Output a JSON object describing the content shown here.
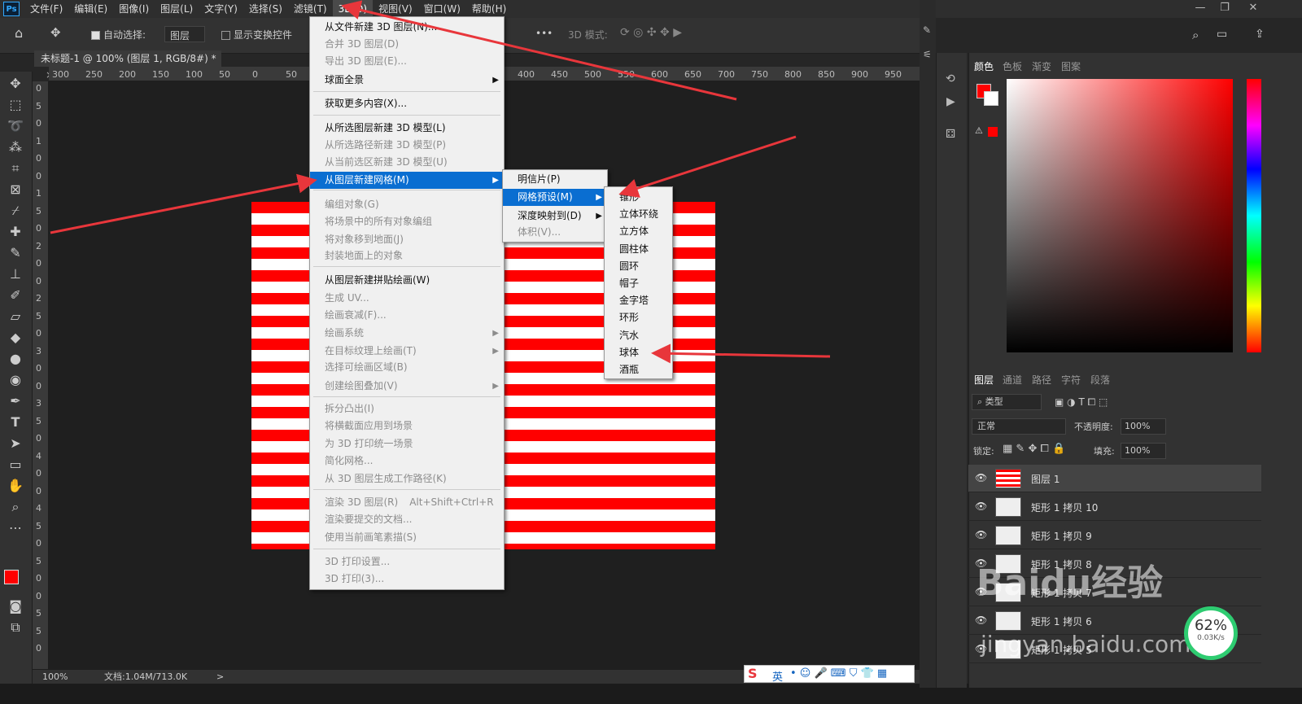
{
  "app": {
    "logo": "Ps"
  },
  "menubar": [
    "文件(F)",
    "编辑(E)",
    "图像(I)",
    "图层(L)",
    "文字(Y)",
    "选择(S)",
    "滤镜(T)",
    "3D(D)",
    "视图(V)",
    "窗口(W)",
    "帮助(H)"
  ],
  "window_controls": {
    "minimize": "—",
    "restore": "❐",
    "close": "✕"
  },
  "options_bar": {
    "auto_select_label": "自动选择:",
    "auto_select_value": "图层",
    "show_transform_label": "显示变换控件",
    "mode_3d_label": "3D 模式:",
    "more": "•••"
  },
  "document_tab": {
    "title": "未标题-1 @ 100% (图层 1, RGB/8#) *",
    "close": "×"
  },
  "hruler_ticks": [
    "300",
    "250",
    "200",
    "150",
    "100",
    "50",
    "0",
    "50",
    "400",
    "450",
    "500",
    "550",
    "600",
    "650",
    "700",
    "750",
    "800",
    "850",
    "900",
    "950"
  ],
  "vruler_ticks": [
    "0",
    "5",
    "0",
    "1",
    "0",
    "0",
    "1",
    "5",
    "0",
    "2",
    "0",
    "0",
    "2",
    "5",
    "0",
    "3",
    "0",
    "0",
    "3",
    "5",
    "0",
    "4",
    "0",
    "0",
    "4",
    "5",
    "0",
    "5",
    "0",
    "0",
    "5",
    "5",
    "0"
  ],
  "status": {
    "zoom": "100%",
    "doc": "文档:1.04M/713.0K",
    "arrow": ">"
  },
  "menu_3d": {
    "items": [
      {
        "label": "从文件新建 3D 图层(N)...",
        "enabled": true
      },
      {
        "label": "合并 3D 图层(D)",
        "enabled": false
      },
      {
        "label": "导出 3D 图层(E)...",
        "enabled": false
      },
      {
        "label": "球面全景",
        "enabled": true,
        "submenu": true
      },
      {
        "label": "获取更多内容(X)...",
        "enabled": true
      },
      {
        "label": "从所选图层新建 3D 模型(L)",
        "enabled": true
      },
      {
        "label": "从所选路径新建 3D 模型(P)",
        "enabled": false
      },
      {
        "label": "从当前选区新建 3D 模型(U)",
        "enabled": false
      },
      {
        "label": "从图层新建网格(M)",
        "enabled": true,
        "submenu": true,
        "highlighted": true
      },
      {
        "label": "编组对象(G)",
        "enabled": false
      },
      {
        "label": "将场景中的所有对象编组",
        "enabled": false
      },
      {
        "label": "将对象移到地面(J)",
        "enabled": false
      },
      {
        "label": "封装地面上的对象",
        "enabled": false
      },
      {
        "label": "从图层新建拼贴绘画(W)",
        "enabled": true
      },
      {
        "label": "生成 UV...",
        "enabled": false
      },
      {
        "label": "绘画衰减(F)...",
        "enabled": false
      },
      {
        "label": "绘画系统",
        "enabled": false,
        "submenu": true
      },
      {
        "label": "在目标纹理上绘画(T)",
        "enabled": false,
        "submenu": true
      },
      {
        "label": "选择可绘画区域(B)",
        "enabled": false
      },
      {
        "label": "创建绘图叠加(V)",
        "enabled": false,
        "submenu": true
      },
      {
        "label": "拆分凸出(I)",
        "enabled": false
      },
      {
        "label": "将横截面应用到场景",
        "enabled": false
      },
      {
        "label": "为 3D 打印统一场景",
        "enabled": false
      },
      {
        "label": "简化网格...",
        "enabled": false
      },
      {
        "label": "从 3D 图层生成工作路径(K)",
        "enabled": false
      },
      {
        "label": "渲染 3D 图层(R)",
        "enabled": false,
        "shortcut": "Alt+Shift+Ctrl+R"
      },
      {
        "label": "渲染要提交的文档...",
        "enabled": false
      },
      {
        "label": "使用当前画笔素描(S)",
        "enabled": false
      },
      {
        "label": "3D 打印设置...",
        "enabled": false
      },
      {
        "label": "3D 打印(3)...",
        "enabled": false
      }
    ]
  },
  "submenu_mesh": {
    "items": [
      {
        "label": "明信片(P)",
        "enabled": true
      },
      {
        "label": "网格预设(M)",
        "enabled": true,
        "submenu": true,
        "highlighted": true
      },
      {
        "label": "深度映射到(D)",
        "enabled": true,
        "submenu": true
      },
      {
        "label": "体积(V)...",
        "enabled": false
      }
    ]
  },
  "submenu_preset": {
    "items": [
      "锥形",
      "立体环绕",
      "立方体",
      "圆柱体",
      "圆环",
      "帽子",
      "金字塔",
      "环形",
      "汽水",
      "球体",
      "酒瓶"
    ]
  },
  "color_panel": {
    "tabs": [
      "颜色",
      "色板",
      "渐变",
      "图案"
    ],
    "foreground": "#ff0000",
    "background": "#ffffff"
  },
  "layers_panel": {
    "tabs": [
      "图层",
      "通道",
      "路径",
      "字符",
      "段落"
    ],
    "filter_label": "类型",
    "blend_mode": "正常",
    "opacity_label": "不透明度:",
    "opacity_value": "100%",
    "lock_label": "锁定:",
    "fill_label": "填充:",
    "fill_value": "100%",
    "layers": [
      {
        "name": "图层 1",
        "selected": true
      },
      {
        "name": "矩形 1 拷贝 10"
      },
      {
        "name": "矩形 1 拷贝 9"
      },
      {
        "name": "矩形 1 拷贝 8"
      },
      {
        "name": "矩形 1 拷贝 7"
      },
      {
        "name": "矩形 1 拷贝 6"
      },
      {
        "name": "矩形 1 拷贝 5"
      }
    ]
  },
  "overlay": {
    "watermark": "Baidu经验",
    "watermark_url": "jingyan.baidu.com",
    "gauge_value": "62%",
    "gauge_speed": "0.03K/s",
    "ime_label": "英"
  },
  "colors": {
    "accent": "#0a6ed1",
    "arrow": "#e8363b",
    "stripe_red": "#ff0000"
  }
}
